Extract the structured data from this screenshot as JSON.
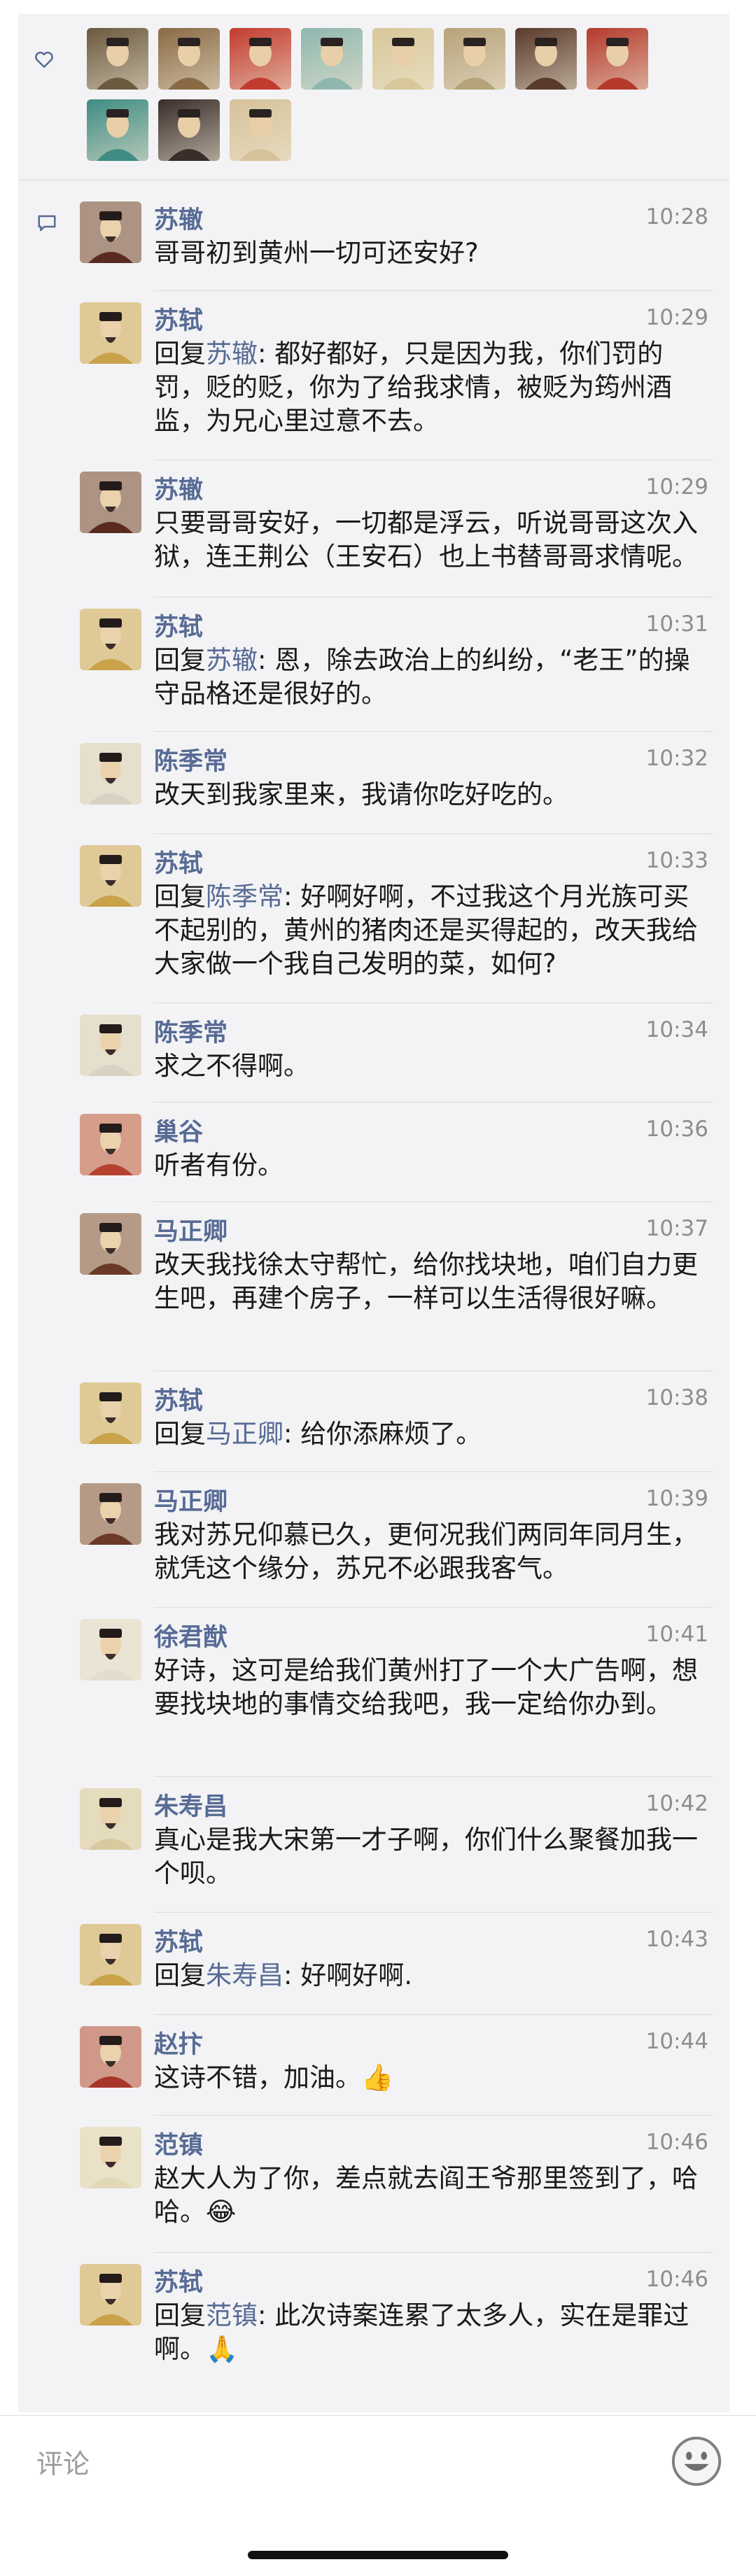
{
  "colors": {
    "name": "#576b95",
    "time": "#8d8d8d",
    "text": "#1a1a1a",
    "background": "#f3f3f5"
  },
  "likes": {
    "icon": "heart-icon",
    "avatars": [
      {
        "icon": "portrait-avatar-1",
        "color": "#6b5a3e"
      },
      {
        "icon": "portrait-avatar-2",
        "color": "#8a6a44"
      },
      {
        "icon": "portrait-avatar-3",
        "color": "#c23b2e"
      },
      {
        "icon": "landscape-avatar-4",
        "color": "#8fb7b0"
      },
      {
        "icon": "portrait-avatar-5",
        "color": "#d8c89a"
      },
      {
        "icon": "portrait-avatar-6",
        "color": "#b7a37a"
      },
      {
        "icon": "portrait-avatar-7",
        "color": "#5a3a2a"
      },
      {
        "icon": "portrait-avatar-8",
        "color": "#b53a2c"
      },
      {
        "icon": "portrait-avatar-9",
        "color": "#3f8c84"
      },
      {
        "icon": "portrait-avatar-10",
        "color": "#3a2d2a"
      },
      {
        "icon": "portrait-avatar-11",
        "color": "#d6c29a"
      }
    ]
  },
  "comments_icon": "comment-icon",
  "comments": [
    {
      "name": "苏辙",
      "time": "10:28",
      "reply_prefix": "",
      "reply_to": "",
      "text": "哥哥初到黄州一切可还安好?",
      "emoji": "",
      "avatar_color": "#5a2a20"
    },
    {
      "name": "苏轼",
      "time": "10:29",
      "reply_prefix": "回复",
      "reply_to": "苏辙",
      "text": ": 都好都好，只是因为我，你们罚的罚，贬的贬，你为了给我求情，被贬为筠州酒监，为兄心里过意不去。",
      "emoji": "",
      "avatar_color": "#c9a24a"
    },
    {
      "name": "苏辙",
      "time": "10:29",
      "reply_prefix": "",
      "reply_to": "",
      "text": "只要哥哥安好，一切都是浮云，听说哥哥这次入狱，连王荆公（王安石）也上书替哥哥求情呢。",
      "emoji": "",
      "avatar_color": "#5a2a20"
    },
    {
      "name": "苏轼",
      "time": "10:31",
      "reply_prefix": "回复",
      "reply_to": "苏辙",
      "text": ": 恩，除去政治上的纠纷，“老王”的操守品格还是很好的。",
      "emoji": "",
      "avatar_color": "#c9a24a"
    },
    {
      "name": "陈季常",
      "time": "10:32",
      "reply_prefix": "",
      "reply_to": "",
      "text": "改天到我家里来，我请你吃好吃的。",
      "emoji": "",
      "avatar_color": "#d9d2c2"
    },
    {
      "name": "苏轼",
      "time": "10:33",
      "reply_prefix": "回复",
      "reply_to": "陈季常",
      "text": ": 好啊好啊，不过我这个月光族可买不起别的，黄州的猪肉还是买得起的，改天我给大家做一个我自己发明的菜，如何?",
      "emoji": "",
      "avatar_color": "#c9a24a"
    },
    {
      "name": "陈季常",
      "time": "10:34",
      "reply_prefix": "",
      "reply_to": "",
      "text": "求之不得啊。",
      "emoji": "",
      "avatar_color": "#d9d2c2"
    },
    {
      "name": "巢谷",
      "time": "10:36",
      "reply_prefix": "",
      "reply_to": "",
      "text": "听者有份。",
      "emoji": "",
      "avatar_color": "#b6412f"
    },
    {
      "name": "马正卿",
      "time": "10:37",
      "reply_prefix": "",
      "reply_to": "",
      "text": "改天我找徐太守帮忙，给你找块地，咱们自力更生吧，再建个房子，一样可以生活得很好嘛。",
      "emoji": "",
      "avatar_color": "#6a3a26"
    },
    {
      "name": "苏轼",
      "time": "10:38",
      "reply_prefix": "回复",
      "reply_to": "马正卿",
      "text": ": 给你添麻烦了。",
      "emoji": "",
      "avatar_color": "#c9a24a"
    },
    {
      "name": "马正卿",
      "time": "10:39",
      "reply_prefix": "",
      "reply_to": "",
      "text": "我对苏兄仰慕已久，更何况我们两同年同月生，就凭这个缘分，苏兄不必跟我客气。",
      "emoji": "",
      "avatar_color": "#6a3a26"
    },
    {
      "name": "徐君猷",
      "time": "10:41",
      "reply_prefix": "",
      "reply_to": "",
      "text": "好诗，这可是给我们黄州打了一个大广告啊，想要找块地的事情交给我吧，我一定给你办到。",
      "emoji": "",
      "avatar_color": "#e3ddd0"
    },
    {
      "name": "朱寿昌",
      "time": "10:42",
      "reply_prefix": "",
      "reply_to": "",
      "text": "真心是我大宋第一才子啊，你们什么聚餐加我一个呗。",
      "emoji": "",
      "avatar_color": "#d8c99e"
    },
    {
      "name": "苏轼",
      "time": "10:43",
      "reply_prefix": "回复",
      "reply_to": "朱寿昌",
      "text": ": 好啊好啊.",
      "emoji": "",
      "avatar_color": "#c9a24a"
    },
    {
      "name": "赵抃",
      "time": "10:44",
      "reply_prefix": "",
      "reply_to": "",
      "text": "这诗不错，加油。",
      "emoji": "👍",
      "avatar_color": "#a9362b"
    },
    {
      "name": "范镇",
      "time": "10:46",
      "reply_prefix": "",
      "reply_to": "",
      "text": "赵大人为了你，差点就去阎王爷那里签到了，哈哈。",
      "emoji": "😂",
      "avatar_color": "#e2d8b8"
    },
    {
      "name": "苏轼",
      "time": "10:46",
      "reply_prefix": "回复",
      "reply_to": "范镇",
      "text": ": 此次诗案连累了太多人，实在是罪过啊。",
      "emoji": "🙏",
      "avatar_color": "#c9a24a"
    }
  ],
  "input": {
    "placeholder": "评论",
    "emoji_button_icon": "smiley-icon"
  }
}
